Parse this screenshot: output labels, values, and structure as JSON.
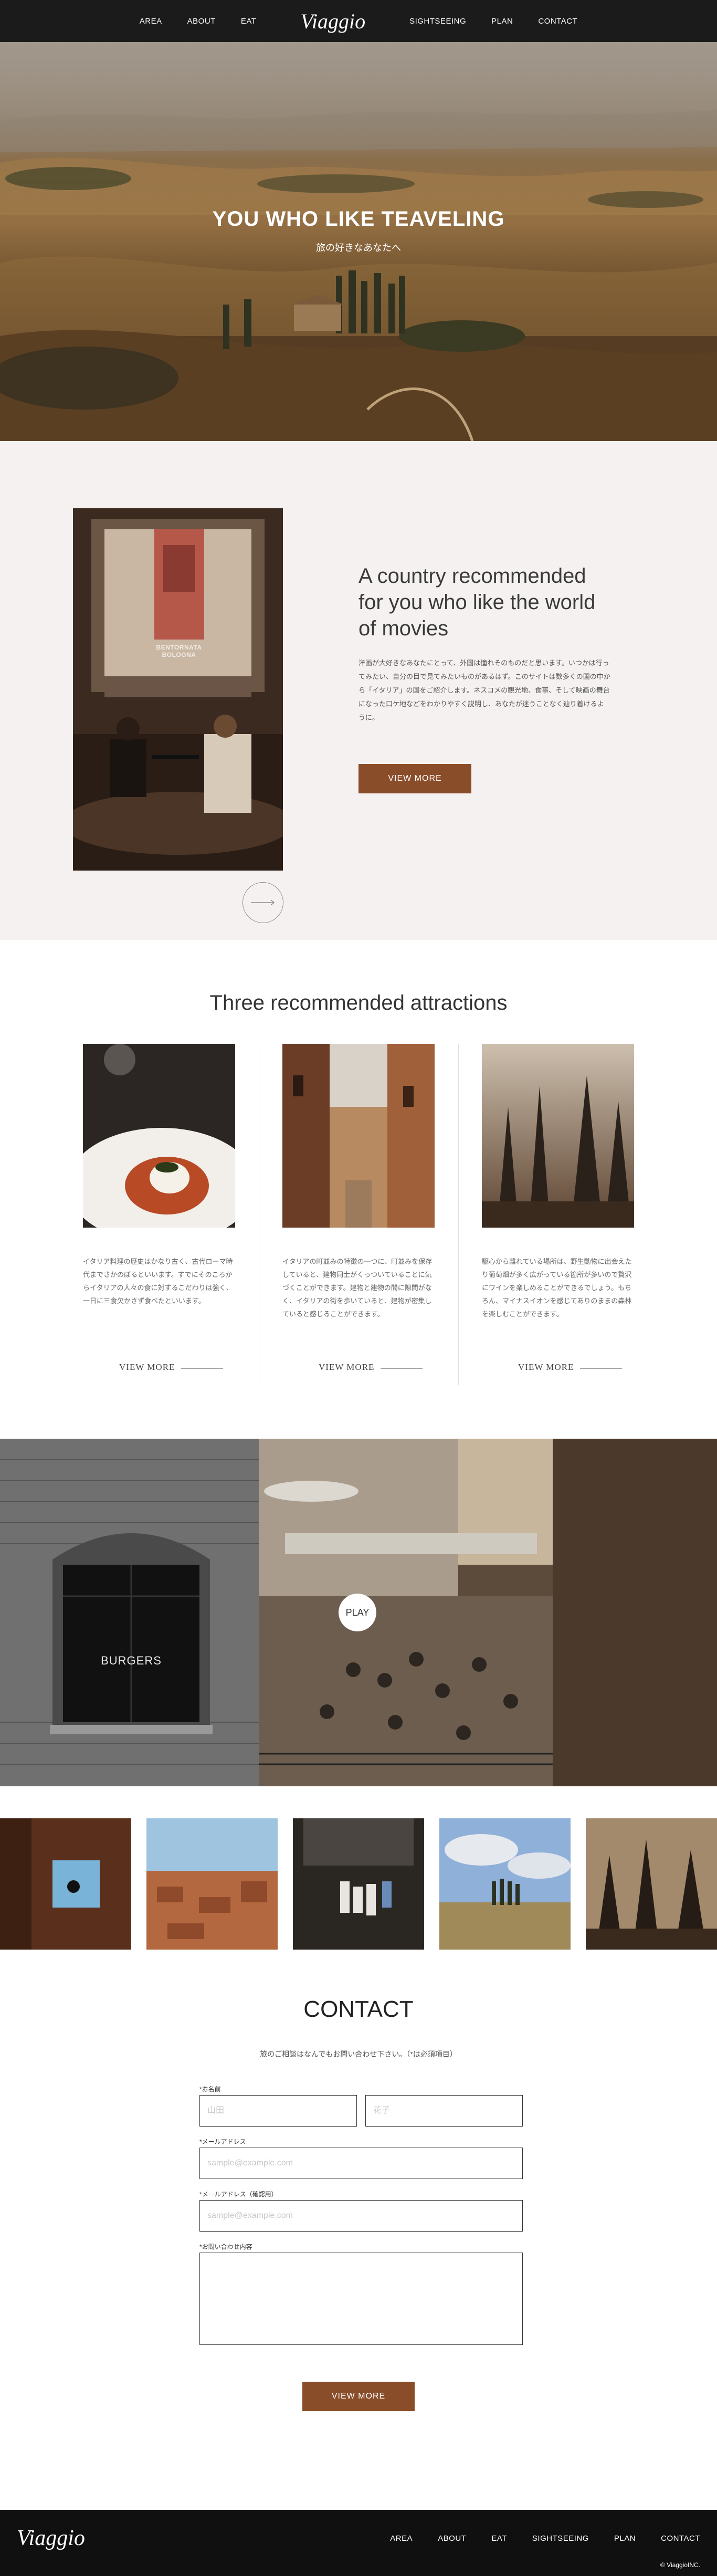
{
  "header": {
    "nav_left": [
      "AREA",
      "ABOUT",
      "EAT"
    ],
    "logo": "Viaggio",
    "nav_right": [
      "SIGHTSEEING",
      "PLAN",
      "CONTACT"
    ]
  },
  "hero": {
    "title": "YOU WHO LIKE TEAVELING",
    "subtitle": "旅の好きなあなたへ"
  },
  "about": {
    "photo_sign": "BENTORNATA BOLOGNA",
    "title": "A country recommended for you who like the world of movies",
    "text": "洋画が大好きなあなたにとって、外国は憧れそのものだと思います。いつかは行ってみたい、自分の目で見てみたいものがあるはず。このサイトは数多くの国の中から「イタリア」の国をご紹介します。ネスコメの観光地、食事、そして映画の舞台になった口ケ地などをわかりやすく説明し、あなたが迷うことなく辿り着けるように。",
    "button": "VIEW MORE"
  },
  "attractions": {
    "title": "Three recommended attractions",
    "cards": [
      {
        "text": "イタリア料理の歴史はかなり古く、古代ローマ時代までさかのぼるといいます。すでにそのころからイタリアの人々の食に対するこだわりは強く、一日に三食欠かさず食べたといいます。",
        "more": "VIEW MORE"
      },
      {
        "text": "イタリアの町並みの特徴の一つに、町並みを保存していると、建物同士がくっついていることに気づくことができます。建物と建物の間に隙間がなく、イタリアの街を歩いていると、建物が密集していると感じることができます。",
        "more": "VIEW MORE"
      },
      {
        "text": "駆心から離れている場所は、野生動物に出会えたり葡萄畑が多く広がっている箇所が多いので贅沢にワインを楽しめることができるでしょう。もちろん、マイナスイオンを感じてありのままの森林を楽しむことができます。",
        "more": "VIEW MORE"
      }
    ]
  },
  "band": {
    "sign": "BURGERS",
    "play": "PLAY"
  },
  "contact": {
    "title": "CONTACT",
    "lead": "旅のご相談はなんでもお問い合わせ下さい。（*は必須項目）",
    "name_label": "*お名前",
    "last_name_placeholder": "山田",
    "first_name_placeholder": "花子",
    "email_label": "*メールアドレス",
    "email_placeholder": "sample@example.com",
    "email_confirm_label": "*メールアドレス（確認用）",
    "email_confirm_placeholder": "sample@example.com",
    "message_label": "*お問い合わせ内容",
    "button": "VIEW MORE"
  },
  "footer": {
    "logo": "Viaggio",
    "nav": [
      "AREA",
      "ABOUT",
      "EAT",
      "SIGHTSEEING",
      "PLAN",
      "CONTACT"
    ],
    "copyright": "© ViaggioINC."
  },
  "colors": {
    "accent": "#8a4d2a",
    "header_bg": "#1b1b1b",
    "about_bg": "#f6f1f1",
    "footer_bg": "#101010"
  }
}
